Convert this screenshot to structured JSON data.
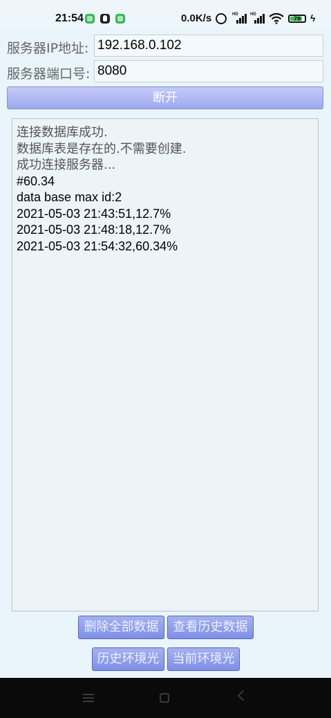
{
  "status_bar": {
    "time": "21:54",
    "net_speed": "0.0K/s",
    "battery_level": "78",
    "icons": [
      "app-green-icon",
      "qq-icon",
      "app-green-icon",
      "alarm-icon",
      "signal-hd-icon",
      "signal-hd-icon",
      "wifi-icon",
      "battery-icon",
      "charging-icon"
    ],
    "battery_color": "#36c24a"
  },
  "form": {
    "ip_label": "服务器IP地址:",
    "ip_value": "192.168.0.102",
    "port_label": "服务器端口号:",
    "port_value": "8080",
    "connect_button": "断开"
  },
  "log": {
    "lines": [
      "连接数据库成功.",
      "数据库表是存在的.不需要创建.",
      "成功连接服务器...",
      "#60.34",
      "data base max id:2",
      "2021-05-03 21:43:51,12.7%",
      "2021-05-03 21:48:18,12.7%",
      "2021-05-03 21:54:32,60.34%"
    ]
  },
  "buttons": {
    "delete_all": "删除全部数据",
    "view_history": "查看历史数据",
    "history_light": "历史环境光",
    "current_light": "当前环境光"
  },
  "nav_bar": {
    "icons": [
      "menu-icon",
      "home-icon",
      "back-icon"
    ]
  },
  "colors": {
    "app_background": "#e9f4fb",
    "button_blue": "#8f9ee9",
    "nav_background": "#0a0a0a"
  }
}
